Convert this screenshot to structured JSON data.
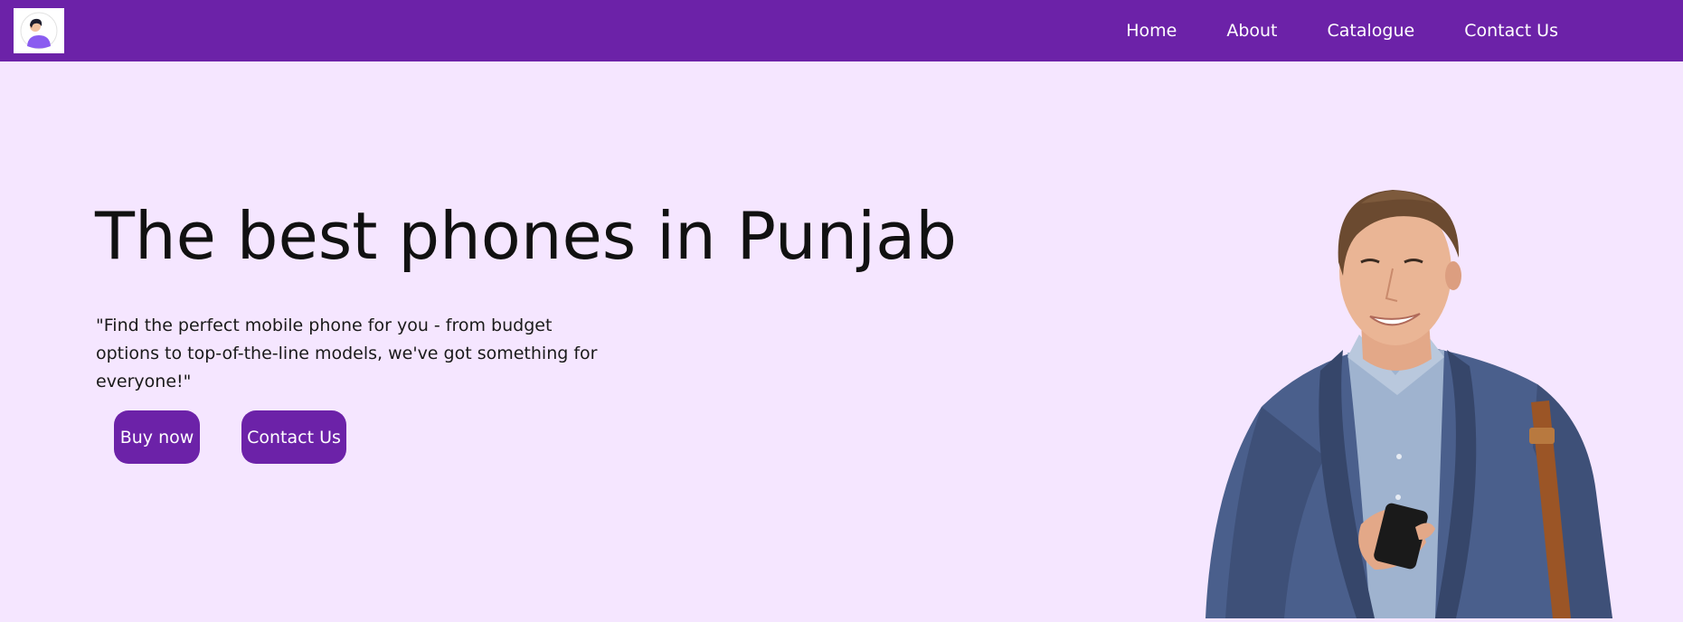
{
  "navbar": {
    "logo_icon": "user-avatar-icon",
    "links": [
      "Home",
      "About",
      "Catalogue",
      "Contact Us"
    ],
    "color": "#6c22a8"
  },
  "hero": {
    "title": "The best phones in Punjab",
    "subtitle": "\"Find the perfect mobile phone for you - from budget options to top-of-the-line models, we've got something for everyone!\"",
    "buttons": {
      "buy": "Buy now",
      "contact": "Contact Us"
    },
    "photo": "man-with-phone-photo"
  },
  "colors": {
    "accent": "#6c22a8",
    "background": "#f5e6ff"
  }
}
